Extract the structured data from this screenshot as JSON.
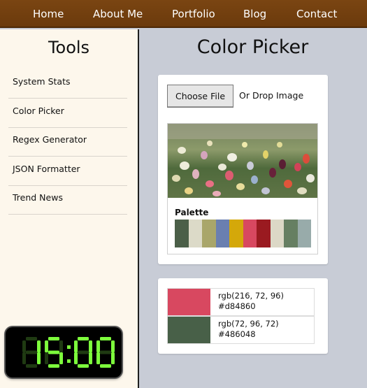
{
  "nav": {
    "items": [
      "Home",
      "About Me",
      "Portfolio",
      "Blog",
      "Contact"
    ]
  },
  "sidebar": {
    "title": "Tools",
    "items": [
      "System Stats",
      "Color Picker",
      "Regex Generator",
      "JSON Formatter",
      "Trend News"
    ]
  },
  "clock": {
    "time": "15:00",
    "color": "#7dff3c"
  },
  "main": {
    "title": "Color Picker",
    "upload": {
      "button_label": "Choose File",
      "drop_label": "Or Drop Image"
    },
    "palette_label": "Palette",
    "palette": [
      "#4b5f48",
      "#dcdac8",
      "#a9a66a",
      "#6a7fb0",
      "#d4a80a",
      "#d84860",
      "#9a1a20",
      "#dcd8c6",
      "#667f62",
      "#98abaa"
    ],
    "picked": [
      {
        "rgb": "rgb(216, 72, 96)",
        "hex": "#d84860"
      },
      {
        "rgb": "rgb(72, 96, 72)",
        "hex": "#486048"
      }
    ]
  }
}
